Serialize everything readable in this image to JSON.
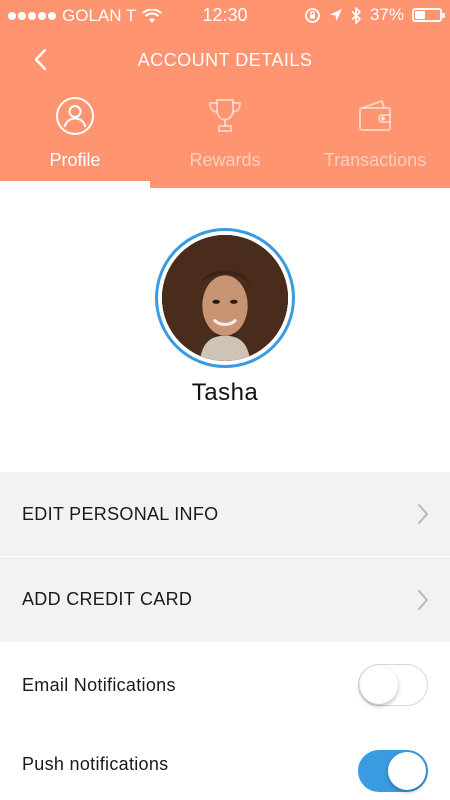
{
  "status_bar": {
    "carrier": "GOLAN T",
    "time": "12:30",
    "battery": "37%",
    "battery_level": 0.37
  },
  "nav": {
    "title": "ACCOUNT DETAILS",
    "back_icon": "chevron-left-icon"
  },
  "tabs": [
    {
      "label": "Profile",
      "icon": "user-icon",
      "active": true
    },
    {
      "label": "Rewards",
      "icon": "trophy-icon",
      "active": false
    },
    {
      "label": "Transactions",
      "icon": "wallet-icon",
      "active": false
    }
  ],
  "profile": {
    "name": "Tasha"
  },
  "menu": [
    {
      "label": "EDIT PERSONAL INFO"
    },
    {
      "label": "ADD CREDIT CARD"
    }
  ],
  "settings": [
    {
      "label": "Email Notifications",
      "enabled": false
    },
    {
      "label": "Push notifications",
      "enabled": true
    }
  ],
  "colors": {
    "header": "#fe9470",
    "accent": "#3a9be0",
    "row_background": "#f2f2f2"
  }
}
